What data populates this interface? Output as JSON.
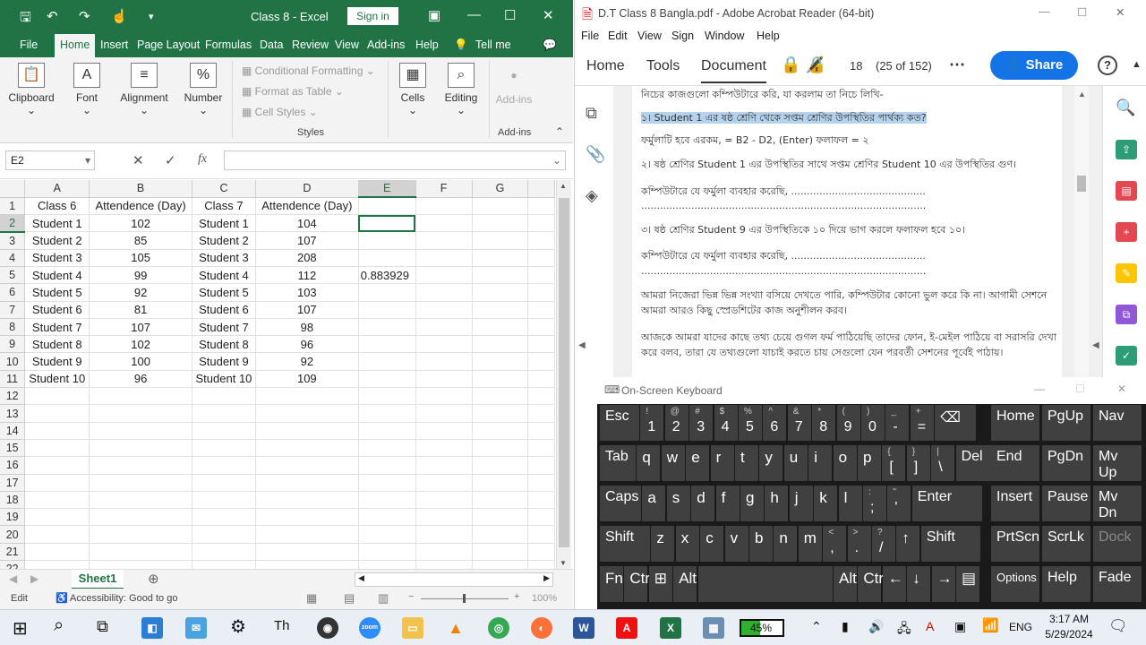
{
  "excel": {
    "title": "Class 8  -  Excel",
    "signin": "Sign in",
    "menu": [
      "File",
      "Home",
      "Insert",
      "Page Layout",
      "Formulas",
      "Data",
      "Review",
      "View",
      "Add-ins",
      "Help",
      "Tell me"
    ],
    "ribbon": {
      "clipboard": "Clipboard",
      "font": "Font",
      "alignment": "Alignment",
      "number": "Number",
      "cond": "Conditional Formatting",
      "fmt_table": "Format as Table",
      "cell_styles": "Cell Styles",
      "styles": "Styles",
      "cells": "Cells",
      "editing": "Editing",
      "addins": "Add-ins",
      "addins_grp": "Add-ins"
    },
    "namebox": "E2",
    "fx": "fx",
    "columns": [
      "A",
      "B",
      "C",
      "D",
      "E",
      "F",
      "G"
    ],
    "rows": [
      [
        "Class 6",
        "Attendence (Day)",
        "Class 7",
        "Attendence (Day)",
        "",
        "",
        ""
      ],
      [
        "Student 1",
        "102",
        "Student 1",
        "104",
        "",
        "",
        ""
      ],
      [
        "Student 2",
        "85",
        "Student 2",
        "107",
        "",
        "",
        ""
      ],
      [
        "Student 3",
        "105",
        "Student 3",
        "208",
        "",
        "",
        ""
      ],
      [
        "Student 4",
        "99",
        "Student 4",
        "112",
        "0.883929",
        "",
        ""
      ],
      [
        "Student 5",
        "92",
        "Student 5",
        "103",
        "",
        "",
        ""
      ],
      [
        "Student 6",
        "81",
        "Student 6",
        "107",
        "",
        "",
        ""
      ],
      [
        "Student 7",
        "107",
        "Student 7",
        "98",
        "",
        "",
        ""
      ],
      [
        "Student 8",
        "102",
        "Student 8",
        "96",
        "",
        "",
        ""
      ],
      [
        "Student 9",
        "100",
        "Student 9",
        "92",
        "",
        "",
        ""
      ],
      [
        "Student 10",
        "96",
        "Student 10",
        "109",
        "",
        "",
        ""
      ],
      [
        "",
        "",
        "",
        "",
        "",
        "",
        ""
      ],
      [
        "",
        "",
        "",
        "",
        "",
        "",
        ""
      ],
      [
        "",
        "",
        "",
        "",
        "",
        "",
        ""
      ],
      [
        "",
        "",
        "",
        "",
        "",
        "",
        ""
      ],
      [
        "",
        "",
        "",
        "",
        "",
        "",
        ""
      ],
      [
        "",
        "",
        "",
        "",
        "",
        "",
        ""
      ],
      [
        "",
        "",
        "",
        "",
        "",
        "",
        ""
      ],
      [
        "",
        "",
        "",
        "",
        "",
        "",
        ""
      ],
      [
        "",
        "",
        "",
        "",
        "",
        "",
        ""
      ],
      [
        "",
        "",
        "",
        "",
        "",
        "",
        ""
      ],
      [
        "",
        "",
        "",
        "",
        "",
        "",
        ""
      ]
    ],
    "sheet": "Sheet1",
    "status": {
      "mode": "Edit",
      "access": "Accessibility: Good to go",
      "zoom": "100%"
    }
  },
  "acrobat": {
    "title": "D.T Class 8 Bangla.pdf - Adobe Acrobat Reader (64-bit)",
    "menu": [
      "File",
      "Edit",
      "View",
      "Sign",
      "Window",
      "Help"
    ],
    "tabs": [
      "Home",
      "Tools",
      "Document"
    ],
    "page": "18",
    "page_of": "(25 of 152)",
    "share": "Share",
    "lines": [
      "নিচের কাজগুলো কম্পিউটারে করি, যা করলাম তা নিচে লিখি-",
      "১। Student 1 এর ষষ্ঠ শ্রেণি থেকে সপ্তম শ্রেণির উপস্থিতির পার্থক্য কত?",
      "ফর্মুলাটি হবে এরকম, = B2 - D2, (Enter) ফলাফল = ২",
      "২। ষষ্ঠ শ্রেণির Student 1 এর উপস্থিতির সাথে সপ্তম শ্রেণির Student 10 এর উপস্থিতির গুণ।",
      "কম্পিউটারে যে ফর্মুলা ব্যবহার করেছি, ...........................................",
      "...........................................................................................",
      "৩।  ষষ্ঠ শ্রেণির Student 9 এর উপস্থিতিকে ১০ দিয়ে ভাগ করলে ফলাফল হবে ১০।",
      "কম্পিউটারে যে ফর্মুলা ব্যবহার করেছি, ...........................................",
      "...........................................................................................",
      "আমরা নিজেরা ভিন্ন ভিন্ন সংখ্যা বসিয়ে দেখতে পারি, কম্পিউটার কোনো ভুল করে কি না। আগামী সেশনে",
      "আমরা আরও কিছু স্প্রেডশিটের কাজ অনুশীলন করব।",
      "আজকে আমরা যাদের কাছে তথ্য চেয়ে গুগল ফর্ম পাঠিয়েছি তাদের ফোন, ই-মেইল পাঠিয়ে বা সরাসরি দেখা",
      "করে বলব, তারা যে তথ্যগুলো যাচাই করতে চায় সেগুলো যেন পরবর্তী সেশনের পূর্বেই পাঠায়।"
    ]
  },
  "osk": {
    "title": "On-Screen Keyboard",
    "rows": [
      [
        [
          "Esc",
          ""
        ],
        [
          "1",
          "!"
        ],
        [
          "2",
          "@"
        ],
        [
          "3",
          "#"
        ],
        [
          "4",
          "$"
        ],
        [
          "5",
          "%"
        ],
        [
          "6",
          "^"
        ],
        [
          "7",
          "&"
        ],
        [
          "8",
          "*"
        ],
        [
          "9",
          "("
        ],
        [
          "0",
          ")"
        ],
        [
          "-",
          "_"
        ],
        [
          "=",
          "+"
        ],
        [
          "⌫",
          ""
        ]
      ],
      [
        [
          "Tab",
          ""
        ],
        [
          "q",
          ""
        ],
        [
          "w",
          ""
        ],
        [
          "e",
          ""
        ],
        [
          "r",
          ""
        ],
        [
          "t",
          ""
        ],
        [
          "y",
          ""
        ],
        [
          "u",
          ""
        ],
        [
          "i",
          ""
        ],
        [
          "o",
          ""
        ],
        [
          "p",
          ""
        ],
        [
          "[",
          "{"
        ],
        [
          "]",
          "}"
        ],
        [
          "\\",
          "|"
        ],
        [
          "Del",
          ""
        ]
      ],
      [
        [
          "Caps",
          ""
        ],
        [
          "a",
          ""
        ],
        [
          "s",
          ""
        ],
        [
          "d",
          ""
        ],
        [
          "f",
          ""
        ],
        [
          "g",
          ""
        ],
        [
          "h",
          ""
        ],
        [
          "j",
          ""
        ],
        [
          "k",
          ""
        ],
        [
          "l",
          ""
        ],
        [
          ";",
          ":"
        ],
        [
          "'",
          "\""
        ],
        [
          "Enter",
          ""
        ]
      ],
      [
        [
          "Shift",
          ""
        ],
        [
          "z",
          ""
        ],
        [
          "x",
          ""
        ],
        [
          "c",
          ""
        ],
        [
          "v",
          ""
        ],
        [
          "b",
          ""
        ],
        [
          "n",
          ""
        ],
        [
          "m",
          ""
        ],
        [
          ",",
          "<"
        ],
        [
          ".",
          ">"
        ],
        [
          "/",
          "?"
        ],
        [
          "↑",
          ""
        ],
        [
          "Shift",
          ""
        ]
      ],
      [
        [
          "Fn",
          ""
        ],
        [
          "Ctrl",
          ""
        ],
        [
          "⊞",
          ""
        ],
        [
          "Alt",
          ""
        ],
        [
          "",
          ""
        ],
        [
          "Alt",
          ""
        ],
        [
          "Ctrl",
          ""
        ],
        [
          "←",
          ""
        ],
        [
          "↓",
          ""
        ],
        [
          "→",
          ""
        ],
        [
          "▤",
          ""
        ]
      ]
    ],
    "nav": [
      [
        "Home",
        "PgUp",
        "Nav"
      ],
      [
        "End",
        "PgDn",
        "Mv Up"
      ],
      [
        "Insert",
        "Pause",
        "Mv Dn"
      ],
      [
        "PrtScn",
        "ScrLk",
        "Dock"
      ],
      [
        "Options",
        "Help",
        "Fade"
      ]
    ]
  },
  "taskbar": {
    "battery": "45%",
    "lang": "ENG",
    "time": "3:17 AM",
    "date": "5/29/2024"
  }
}
